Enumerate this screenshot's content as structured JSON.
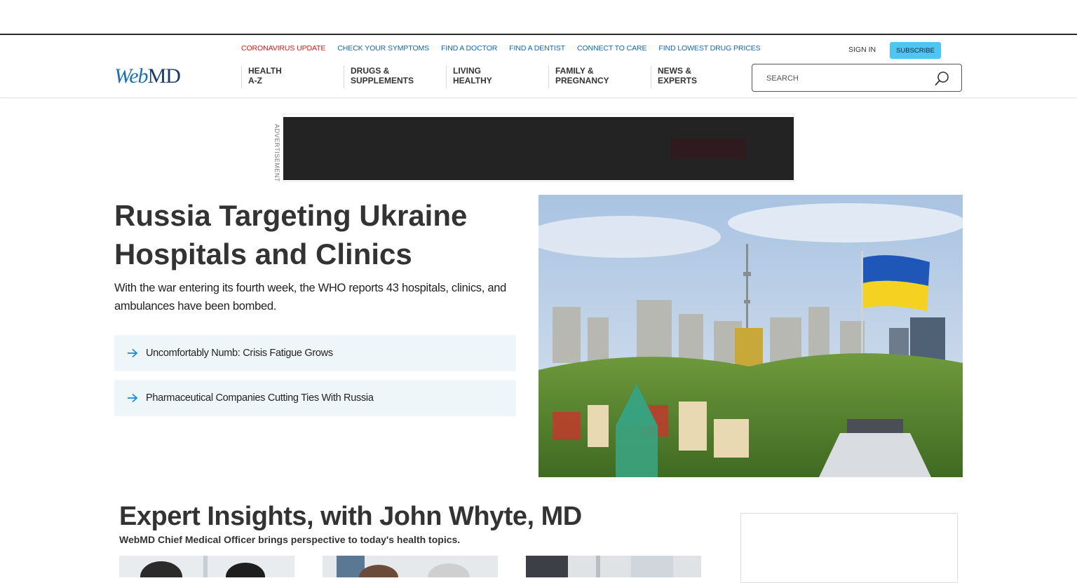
{
  "utility_links": [
    {
      "label": "CORONAVIRUS UPDATE",
      "highlight": true
    },
    {
      "label": "CHECK YOUR SYMPTOMS"
    },
    {
      "label": "FIND A DOCTOR"
    },
    {
      "label": "FIND A DENTIST"
    },
    {
      "label": "CONNECT TO CARE"
    },
    {
      "label": "FIND LOWEST DRUG PRICES"
    }
  ],
  "account": {
    "sign_in": "SIGN IN",
    "subscribe": "SUBSCRIBE"
  },
  "logo": {
    "web": "Web",
    "md": "MD"
  },
  "nav": [
    {
      "line1": "HEALTH",
      "line2": "A-Z"
    },
    {
      "line1": "DRUGS &",
      "line2": "SUPPLEMENTS"
    },
    {
      "line1": "LIVING",
      "line2": "HEALTHY"
    },
    {
      "line1": "FAMILY &",
      "line2": "PREGNANCY"
    },
    {
      "line1": "NEWS &",
      "line2": "EXPERTS"
    }
  ],
  "search": {
    "placeholder": "SEARCH"
  },
  "ad": {
    "label": "ADVERTISEMENT"
  },
  "hero": {
    "title": "Russia Targeting Ukraine Hospitals and Clinics",
    "subtitle": "With the war entering its fourth week, the WHO reports 43 hospitals, clinics, and ambulances have been bombed.",
    "related": [
      "Uncomfortably Numb: Crisis Fatigue Grows",
      "Pharmaceutical Companies Cutting Ties With Russia"
    ]
  },
  "expert": {
    "title": "Expert Insights, with John Whyte, MD",
    "subtitle": "WebMD Chief Medical Officer brings perspective to today's health topics."
  },
  "colors": {
    "accent": "#1566a6",
    "alert": "#d11a1a",
    "subscribe": "#4ec6f1",
    "related_bg": "#eef6f9"
  }
}
